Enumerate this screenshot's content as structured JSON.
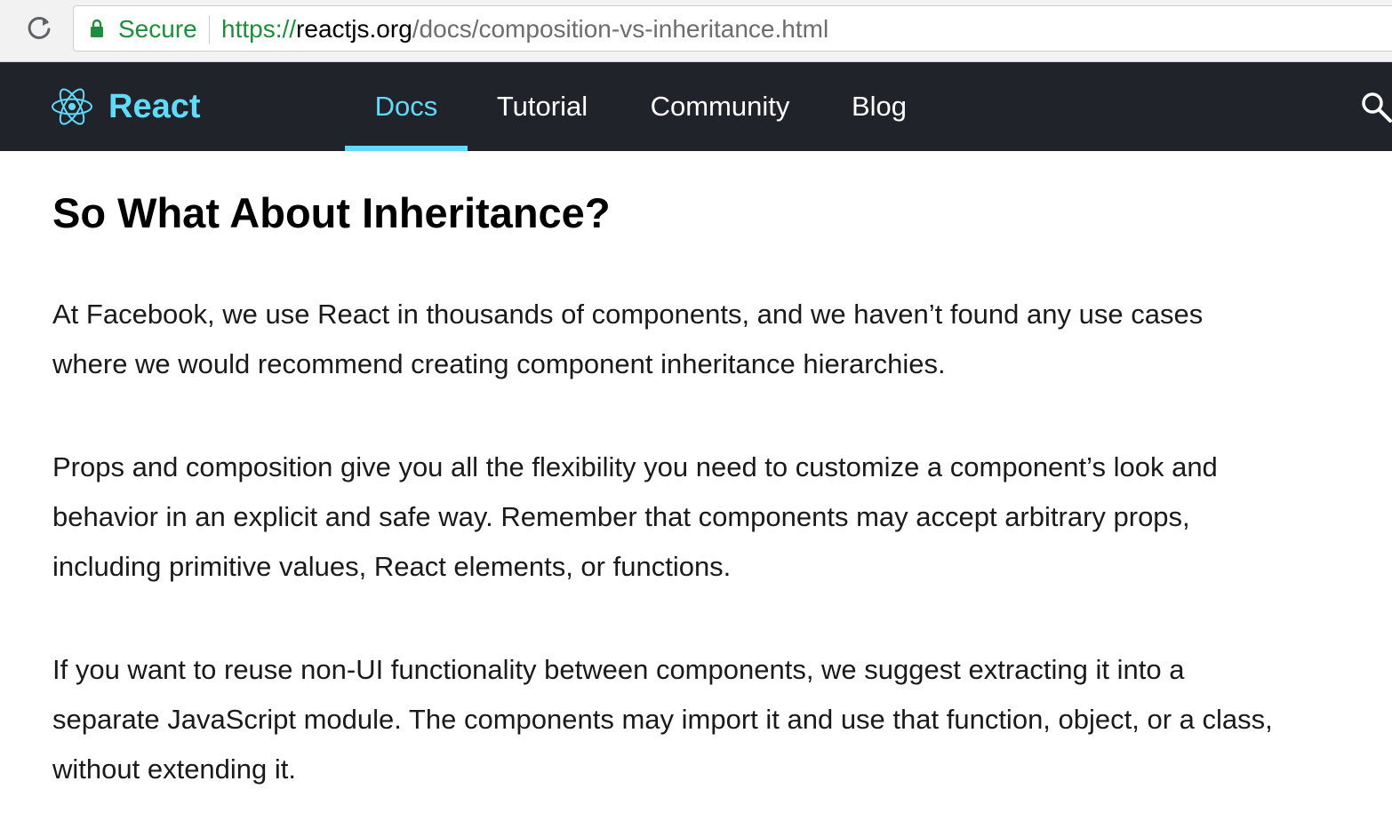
{
  "browser": {
    "secure_label": "Secure",
    "url_scheme": "https://",
    "url_host": "reactjs.org",
    "url_path": "/docs/composition-vs-inheritance.html",
    "reload_icon": "reload-icon",
    "lock_icon": "lock-icon",
    "secure_color": "#1e8e3e"
  },
  "navbar": {
    "brand": "React",
    "brand_color": "#61dafb",
    "background": "#20232a",
    "items": [
      {
        "label": "Docs",
        "active": true
      },
      {
        "label": "Tutorial",
        "active": false
      },
      {
        "label": "Community",
        "active": false
      },
      {
        "label": "Blog",
        "active": false
      }
    ],
    "search_icon": "search-icon"
  },
  "article": {
    "heading": "So What About Inheritance?",
    "paragraphs": [
      "At Facebook, we use React in thousands of components, and we haven’t found any use cases where we would recommend creating component inheritance hierarchies.",
      "Props and composition give you all the flexibility you need to customize a component’s look and behavior in an explicit and safe way. Remember that components may accept arbitrary props, including primitive values, React elements, or functions.",
      "If you want to reuse non-UI functionality between components, we suggest extracting it into a separate JavaScript module. The components may import it and use that function, object, or a class, without extending it."
    ]
  }
}
